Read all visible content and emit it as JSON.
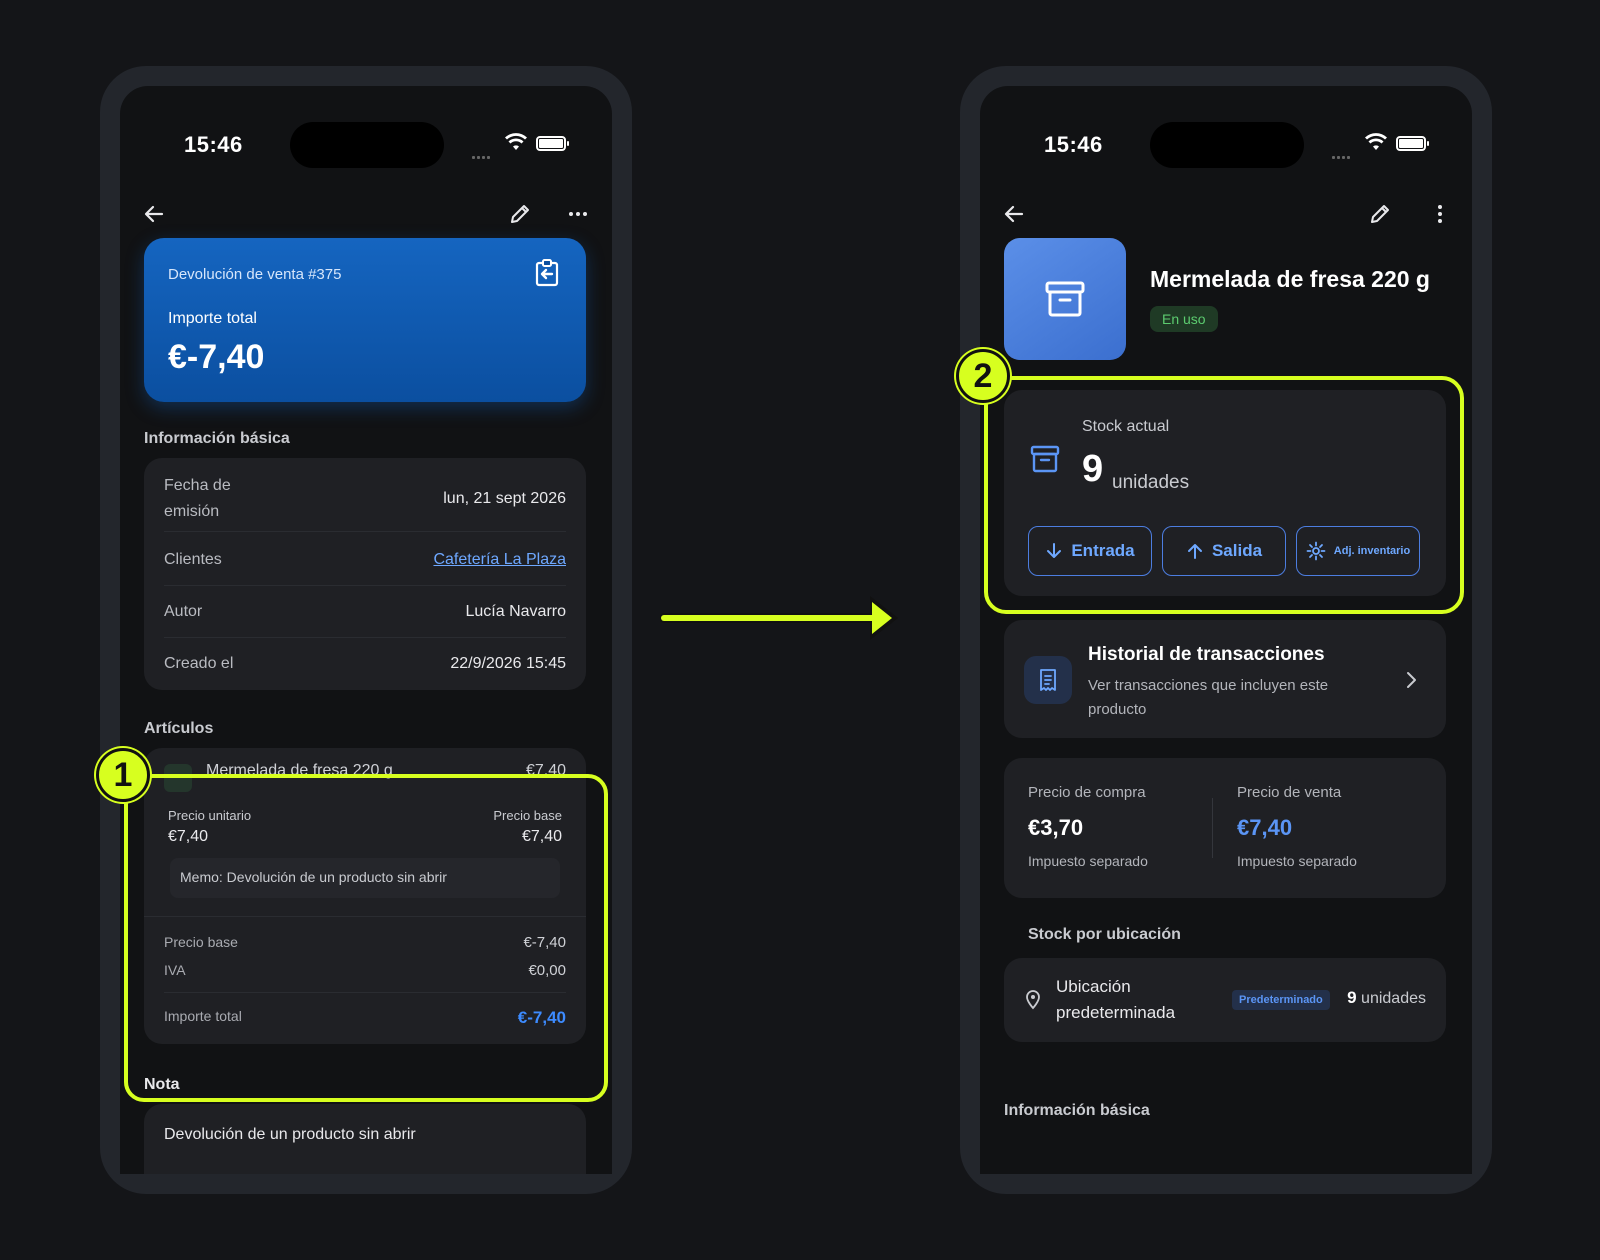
{
  "left_screen": {
    "status": {
      "time": "15:46"
    },
    "hero": {
      "title": "Devolución de venta #375",
      "label": "Importe total",
      "amount": "€-7,40"
    },
    "basic_info": {
      "title": "Información básica",
      "rows": [
        {
          "key": "Fecha de emisión",
          "value": "lun, 21 sept 2026"
        },
        {
          "key": "Clientes",
          "value": "Cafetería La Plaza"
        },
        {
          "key": "Autor",
          "value": "Lucía Navarro"
        },
        {
          "key": "Creado el",
          "value": "22/9/2026 15:45"
        }
      ]
    },
    "items": {
      "title": "Artículos",
      "item_name": "Mermelada de fresa 220 g",
      "item_amount": "€7,40",
      "unit_price_label": "Precio unitario",
      "unit_price": "€7,40",
      "base_price_label": "Precio base",
      "base_price": "€7,40",
      "memo": "Memo: Devolución de un producto sin abrir",
      "summary": [
        {
          "key": "Precio base",
          "value": "€-7,40"
        },
        {
          "key": "IVA",
          "value": "€0,00"
        }
      ],
      "total_label": "Importe total",
      "total": "€-7,40"
    },
    "note": {
      "title": "Nota",
      "text": "Devolución de un producto sin abrir"
    }
  },
  "right_screen": {
    "status": {
      "time": "15:46"
    },
    "product": {
      "name": "Mermelada de fresa 220 g",
      "status": "En uso"
    },
    "stock": {
      "label": "Stock actual",
      "count": "9",
      "unit": "unidades",
      "buttons": {
        "in": "Entrada",
        "out": "Salida",
        "adjust": "Adj. inventario"
      }
    },
    "history": {
      "title": "Historial de transacciones",
      "subtitle": "Ver transacciones que incluyen este producto"
    },
    "prices": {
      "purchase_label": "Precio de compra",
      "purchase": "€3,70",
      "purchase_note": "Impuesto separado",
      "sale_label": "Precio de venta",
      "sale": "€7,40",
      "sale_note": "Impuesto separado"
    },
    "locations": {
      "title": "Stock por ubicación",
      "name": "Ubicación predeterminada",
      "badge": "Predeterminado",
      "count": "9",
      "unit": "unidades"
    },
    "basic_info_title": "Información básica"
  },
  "markers": {
    "one": "1",
    "two": "2"
  },
  "colors": {
    "highlight": "#d7ff1f",
    "accent": "#3d8bff",
    "hero": "#1565c0"
  }
}
